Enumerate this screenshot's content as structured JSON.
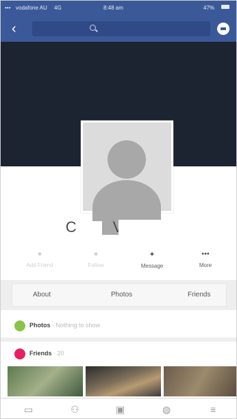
{
  "status_bar": {
    "carrier": "vodafone AU",
    "network": "4G",
    "time": "8:48 am",
    "battery": "47%"
  },
  "nav": {
    "back_label": "‹",
    "search_placeholder": "",
    "messenger_icon": "messenger-icon"
  },
  "profile": {
    "name_visible_part1": "C",
    "name_visible_part2": "V"
  },
  "actions": [
    {
      "label": "Add Friend",
      "icon": "add-friend-icon",
      "state": "disabled"
    },
    {
      "label": "Follow",
      "icon": "follow-icon",
      "state": "disabled"
    },
    {
      "label": "Message",
      "icon": "message-icon",
      "state": "enabled"
    },
    {
      "label": "More",
      "icon": "more-icon",
      "state": "enabled"
    }
  ],
  "tabs": [
    {
      "label": "About"
    },
    {
      "label": "Photos"
    },
    {
      "label": "Friends"
    }
  ],
  "sections": {
    "photos": {
      "title": "Photos",
      "subtitle": " · Nothing to show",
      "color": "#8bc34a"
    },
    "friends": {
      "title": "Friends",
      "subtitle": " · 20",
      "color": "#e91e63"
    }
  },
  "colors": {
    "brand": "#3b5998",
    "cover": "#1c2331"
  }
}
